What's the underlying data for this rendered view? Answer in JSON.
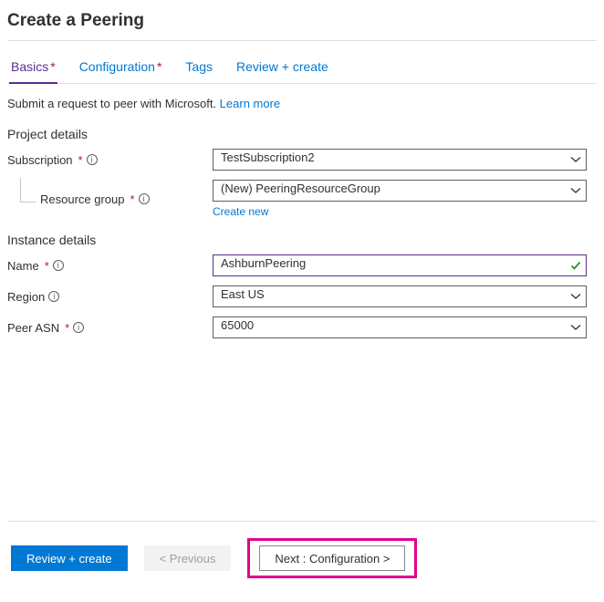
{
  "title": "Create a Peering",
  "tabs": {
    "basics": "Basics",
    "configuration": "Configuration",
    "tags": "Tags",
    "review": "Review + create"
  },
  "intro": {
    "text": "Submit a request to peer with Microsoft.",
    "link": "Learn more"
  },
  "sections": {
    "project": "Project details",
    "instance": "Instance details"
  },
  "labels": {
    "subscription": "Subscription",
    "resource_group": "Resource group",
    "name": "Name",
    "region": "Region",
    "peer_asn": "Peer ASN"
  },
  "values": {
    "subscription": "TestSubscription2",
    "resource_group": "(New) PeeringResourceGroup",
    "name": "AshburnPeering",
    "region": "East US",
    "peer_asn": "65000"
  },
  "links": {
    "create_new": "Create new"
  },
  "footer": {
    "review": "Review + create",
    "previous": "< Previous",
    "next": "Next : Configuration >"
  }
}
